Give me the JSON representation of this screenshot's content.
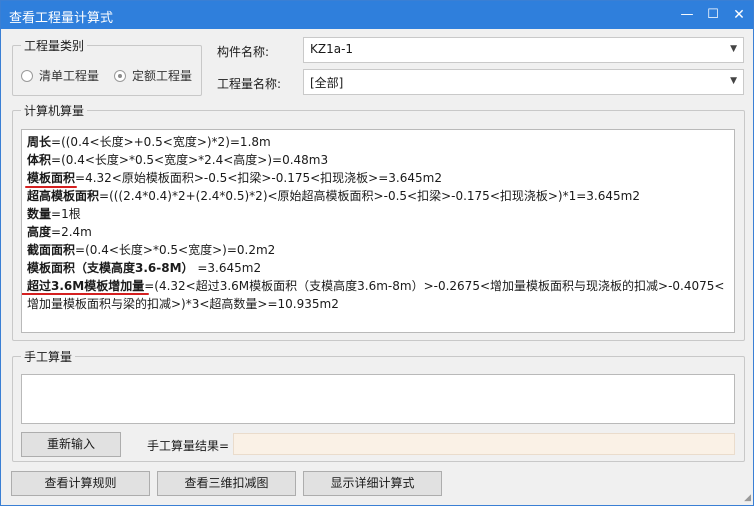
{
  "window": {
    "title": "查看工程量计算式",
    "min_glyph": "—",
    "max_glyph": "☐",
    "close_glyph": "✕"
  },
  "category": {
    "legend": "工程量类别",
    "options": [
      {
        "label": "清单工程量",
        "checked": false
      },
      {
        "label": "定额工程量",
        "checked": true
      }
    ]
  },
  "component": {
    "label": "构件名称:",
    "value": "KZ1a-1"
  },
  "quantity": {
    "label": "工程量名称:",
    "value": "[全部]"
  },
  "computer_calc": {
    "legend": "计算机算量",
    "lines": [
      {
        "name": "周长",
        "formula": "=((0.4<长度>+0.5<宽度>)*2)=1.8m"
      },
      {
        "name": "体积",
        "formula": "=(0.4<长度>*0.5<宽度>*2.4<高度>)=0.48m3"
      },
      {
        "name": "模板面积",
        "formula": "=4.32<原始模板面积>-0.5<扣梁>-0.175<扣现浇板>=3.645m2"
      },
      {
        "name": "超高模板面积",
        "formula": "=(((2.4*0.4)*2+(2.4*0.5)*2)<原始超高模板面积>-0.5<扣梁>-0.175<扣现浇板>)*1=3.645m2"
      },
      {
        "name": "数量",
        "formula": "=1根"
      },
      {
        "name": "高度",
        "formula": "=2.4m"
      },
      {
        "name": "截面面积",
        "formula": "=(0.4<长度>*0.5<宽度>)=0.2m2"
      },
      {
        "name": "模板面积（支模高度3.6-8M）",
        "formula": "  =3.645m2"
      },
      {
        "name": "超过3.6M模板增加量",
        "formula": "=(4.32<超过3.6M模板面积（支模高度3.6m-8m）>-0.2675<增加量模板面积与现浇板的扣减>-0.4075<增加量模板面积与梁的扣减>)*3<超高数量>=10.935m2"
      }
    ],
    "highlight_color": "#d42020"
  },
  "manual_calc": {
    "legend": "手工算量",
    "value": ""
  },
  "buttons": {
    "reenter": "重新输入",
    "result_label": "手工算量结果=",
    "result_value": "",
    "view_rules": "查看计算规则",
    "view_3d": "查看三维扣减图",
    "show_detail": "显示详细计算式"
  }
}
